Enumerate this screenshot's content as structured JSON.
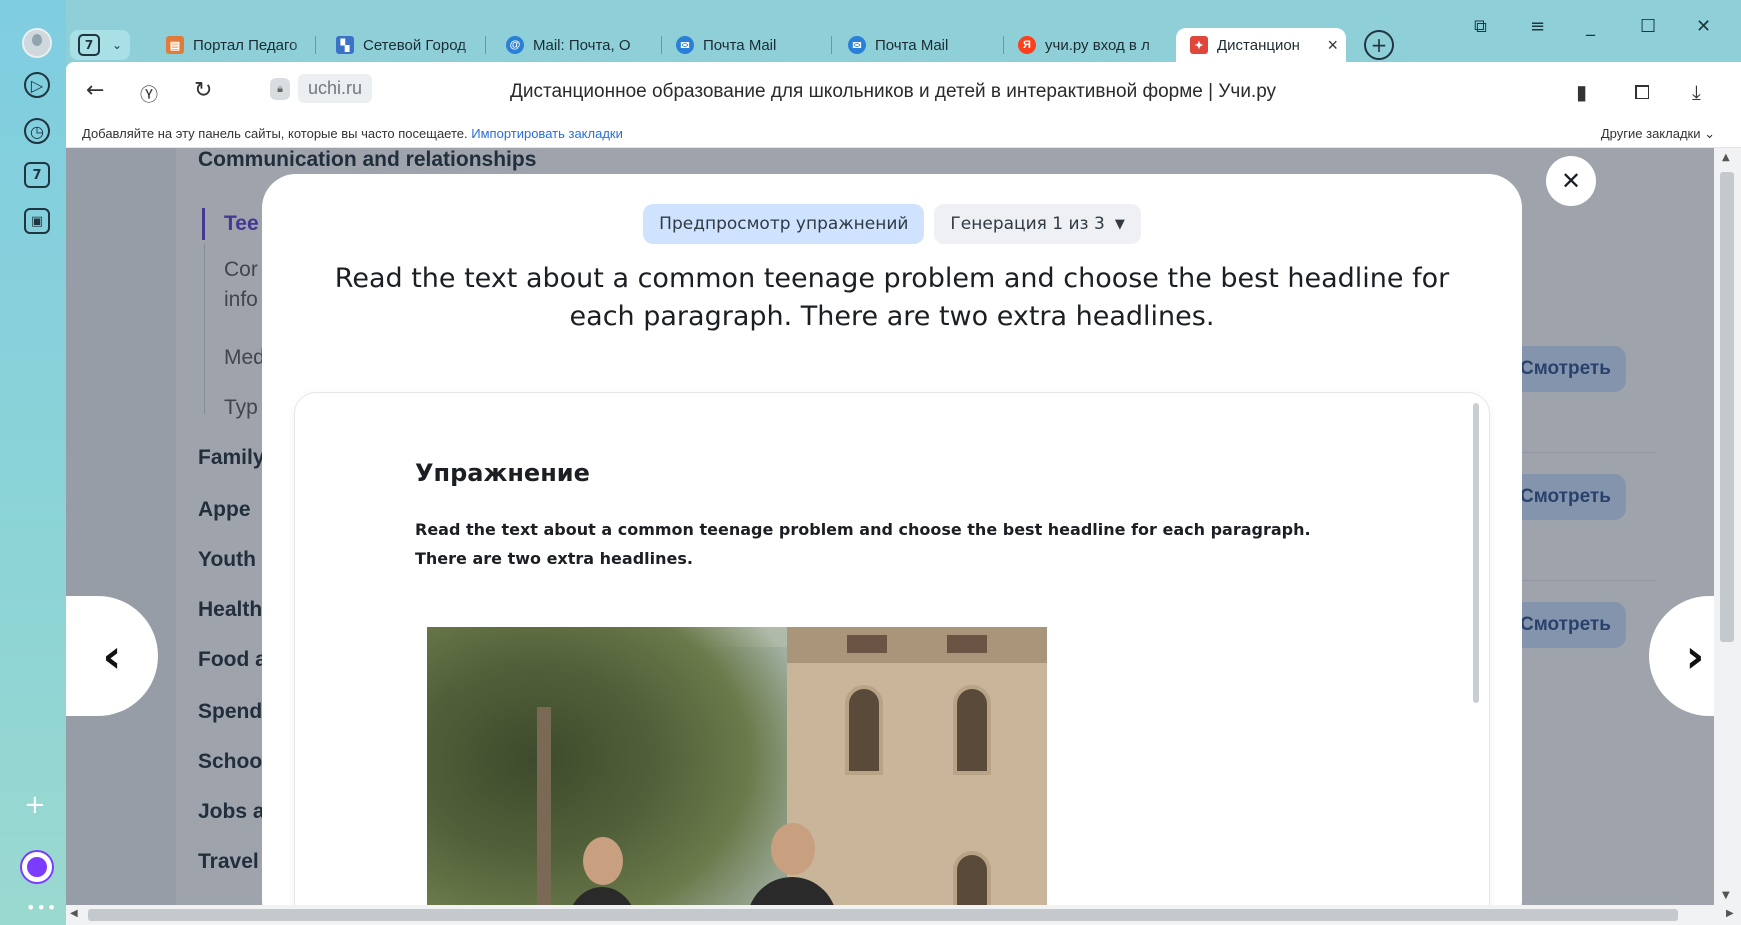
{
  "browser": {
    "tab_count": "7",
    "tabs": [
      {
        "label": "Портал Педаго",
        "icon": "doc-portal-icon",
        "color": "#e07b3a"
      },
      {
        "label": "Сетевой Город",
        "icon": "city-network-icon",
        "color": "#3a72c8"
      },
      {
        "label": "Mail: Почта, О",
        "icon": "at-sign-icon",
        "color": "#2a7fd6"
      },
      {
        "label": "Почта Mail",
        "icon": "mail-icon",
        "color": "#2a7fd6"
      },
      {
        "label": "Почта Mail",
        "icon": "mail-icon",
        "color": "#2a7fd6"
      },
      {
        "label": "учи.ру вход в л",
        "icon": "yandex-icon",
        "color": "#fc3f1d"
      },
      {
        "label": "Дистанцион",
        "icon": "uchi-icon",
        "color": "#e0463a"
      }
    ],
    "domain": "uchi.ru",
    "page_title": "Дистанционное образование для школьников и детей в интерактивной форме | Учи.ру",
    "bookmarks_hint": "Добавляйте на эту панель сайты, которые вы часто посещаете.",
    "bookmarks_import": "Импортировать закладки",
    "bookmarks_other": "Другие закладки"
  },
  "background": {
    "topics": [
      {
        "label": "Communication and relationships",
        "kind": "heading"
      },
      {
        "label": "Tee",
        "kind": "active"
      },
      {
        "label": "Cor",
        "kind": "sub"
      },
      {
        "label": "info",
        "kind": "sub"
      },
      {
        "label": "Med",
        "kind": "sub"
      },
      {
        "label": "Typ",
        "kind": "sub"
      },
      {
        "label": "Family",
        "kind": "heading"
      },
      {
        "label": "Appe",
        "kind": "heading"
      },
      {
        "label": "Youth",
        "kind": "heading"
      },
      {
        "label": "Health",
        "kind": "heading"
      },
      {
        "label": "Food a",
        "kind": "heading"
      },
      {
        "label": "Spend",
        "kind": "heading"
      },
      {
        "label": "Schoo",
        "kind": "heading"
      },
      {
        "label": "Jobs a",
        "kind": "heading"
      },
      {
        "label": "Travel",
        "kind": "heading"
      }
    ],
    "view_button_label": "Смотреть"
  },
  "modal": {
    "preview_label": "Предпросмотр упражнений",
    "generation_label": "Генерация 1 из 3",
    "question": "Read the text about a common teenage problem and choose the best headline for each paragraph. There are two extra headlines.",
    "exercise_title": "Упражнение",
    "exercise_text": "Read the text about a common teenage problem and choose the best headline for each paragraph. There are two extra headlines.",
    "prev_icon": "chevron-left-icon",
    "next_icon": "chevron-right-icon",
    "close_icon": "close-icon"
  }
}
